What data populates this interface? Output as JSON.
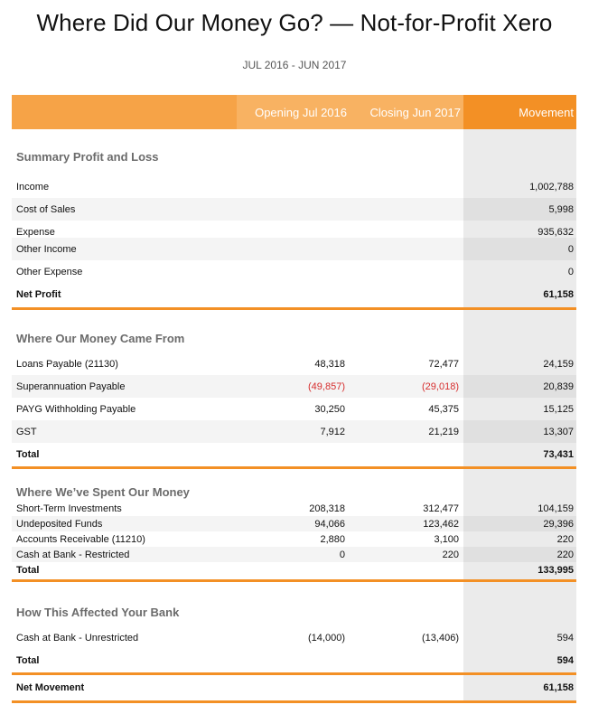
{
  "title": "Where Did Our Money Go? —  Not-for-Profit Xero",
  "period": "JUL 2016 - JUN 2017",
  "columns": [
    "Opening Jul 2016",
    "Closing Jun 2017",
    "Movement"
  ],
  "sections": {
    "pnl": {
      "heading": "Summary Profit and Loss",
      "rows": [
        {
          "label": "Income",
          "movement": "1,002,788"
        },
        {
          "label": "Cost of Sales",
          "movement": "5,998"
        },
        {
          "label": "Expense",
          "movement": "935,632"
        },
        {
          "label": "Other Income",
          "movement": "0"
        },
        {
          "label": "Other Expense",
          "movement": "0"
        },
        {
          "label": "Net Profit",
          "movement": "61,158"
        }
      ]
    },
    "came_from": {
      "heading": "Where Our Money Came From",
      "rows": [
        {
          "label": "Loans Payable (21130)",
          "opening": "48,318",
          "closing": "72,477",
          "movement": "24,159"
        },
        {
          "label": "Superannuation Payable",
          "opening": "(49,857)",
          "closing": "(29,018)",
          "movement": "20,839"
        },
        {
          "label": "PAYG Withholding Payable",
          "opening": "30,250",
          "closing": "45,375",
          "movement": "15,125"
        },
        {
          "label": "GST",
          "opening": "7,912",
          "closing": "21,219",
          "movement": "13,307"
        },
        {
          "label": "Total",
          "movement": "73,431"
        }
      ]
    },
    "spent": {
      "heading": "Where We’ve Spent Our Money",
      "rows": [
        {
          "label": "Short-Term Investments",
          "opening": "208,318",
          "closing": "312,477",
          "movement": "104,159"
        },
        {
          "label": "Undeposited Funds",
          "opening": "94,066",
          "closing": "123,462",
          "movement": "29,396"
        },
        {
          "label": "Accounts Receivable (11210)",
          "opening": "2,880",
          "closing": "3,100",
          "movement": "220"
        },
        {
          "label": "Cash at Bank - Restricted",
          "opening": "0",
          "closing": "220",
          "movement": "220"
        },
        {
          "label": "Total",
          "movement": "133,995"
        }
      ]
    },
    "bank": {
      "heading": "How This Affected Your Bank",
      "rows": [
        {
          "label": "Cash at Bank - Unrestricted",
          "opening": "(14,000)",
          "closing": "(13,406)",
          "movement": "594"
        },
        {
          "label": "Total",
          "movement": "594"
        }
      ]
    },
    "net": {
      "label": "Net Movement",
      "movement": "61,158"
    }
  },
  "colors": {
    "header_orange": "#f39025",
    "header_light": "#f8b262",
    "negative": "#d62e2e",
    "rule": "#f39025"
  }
}
